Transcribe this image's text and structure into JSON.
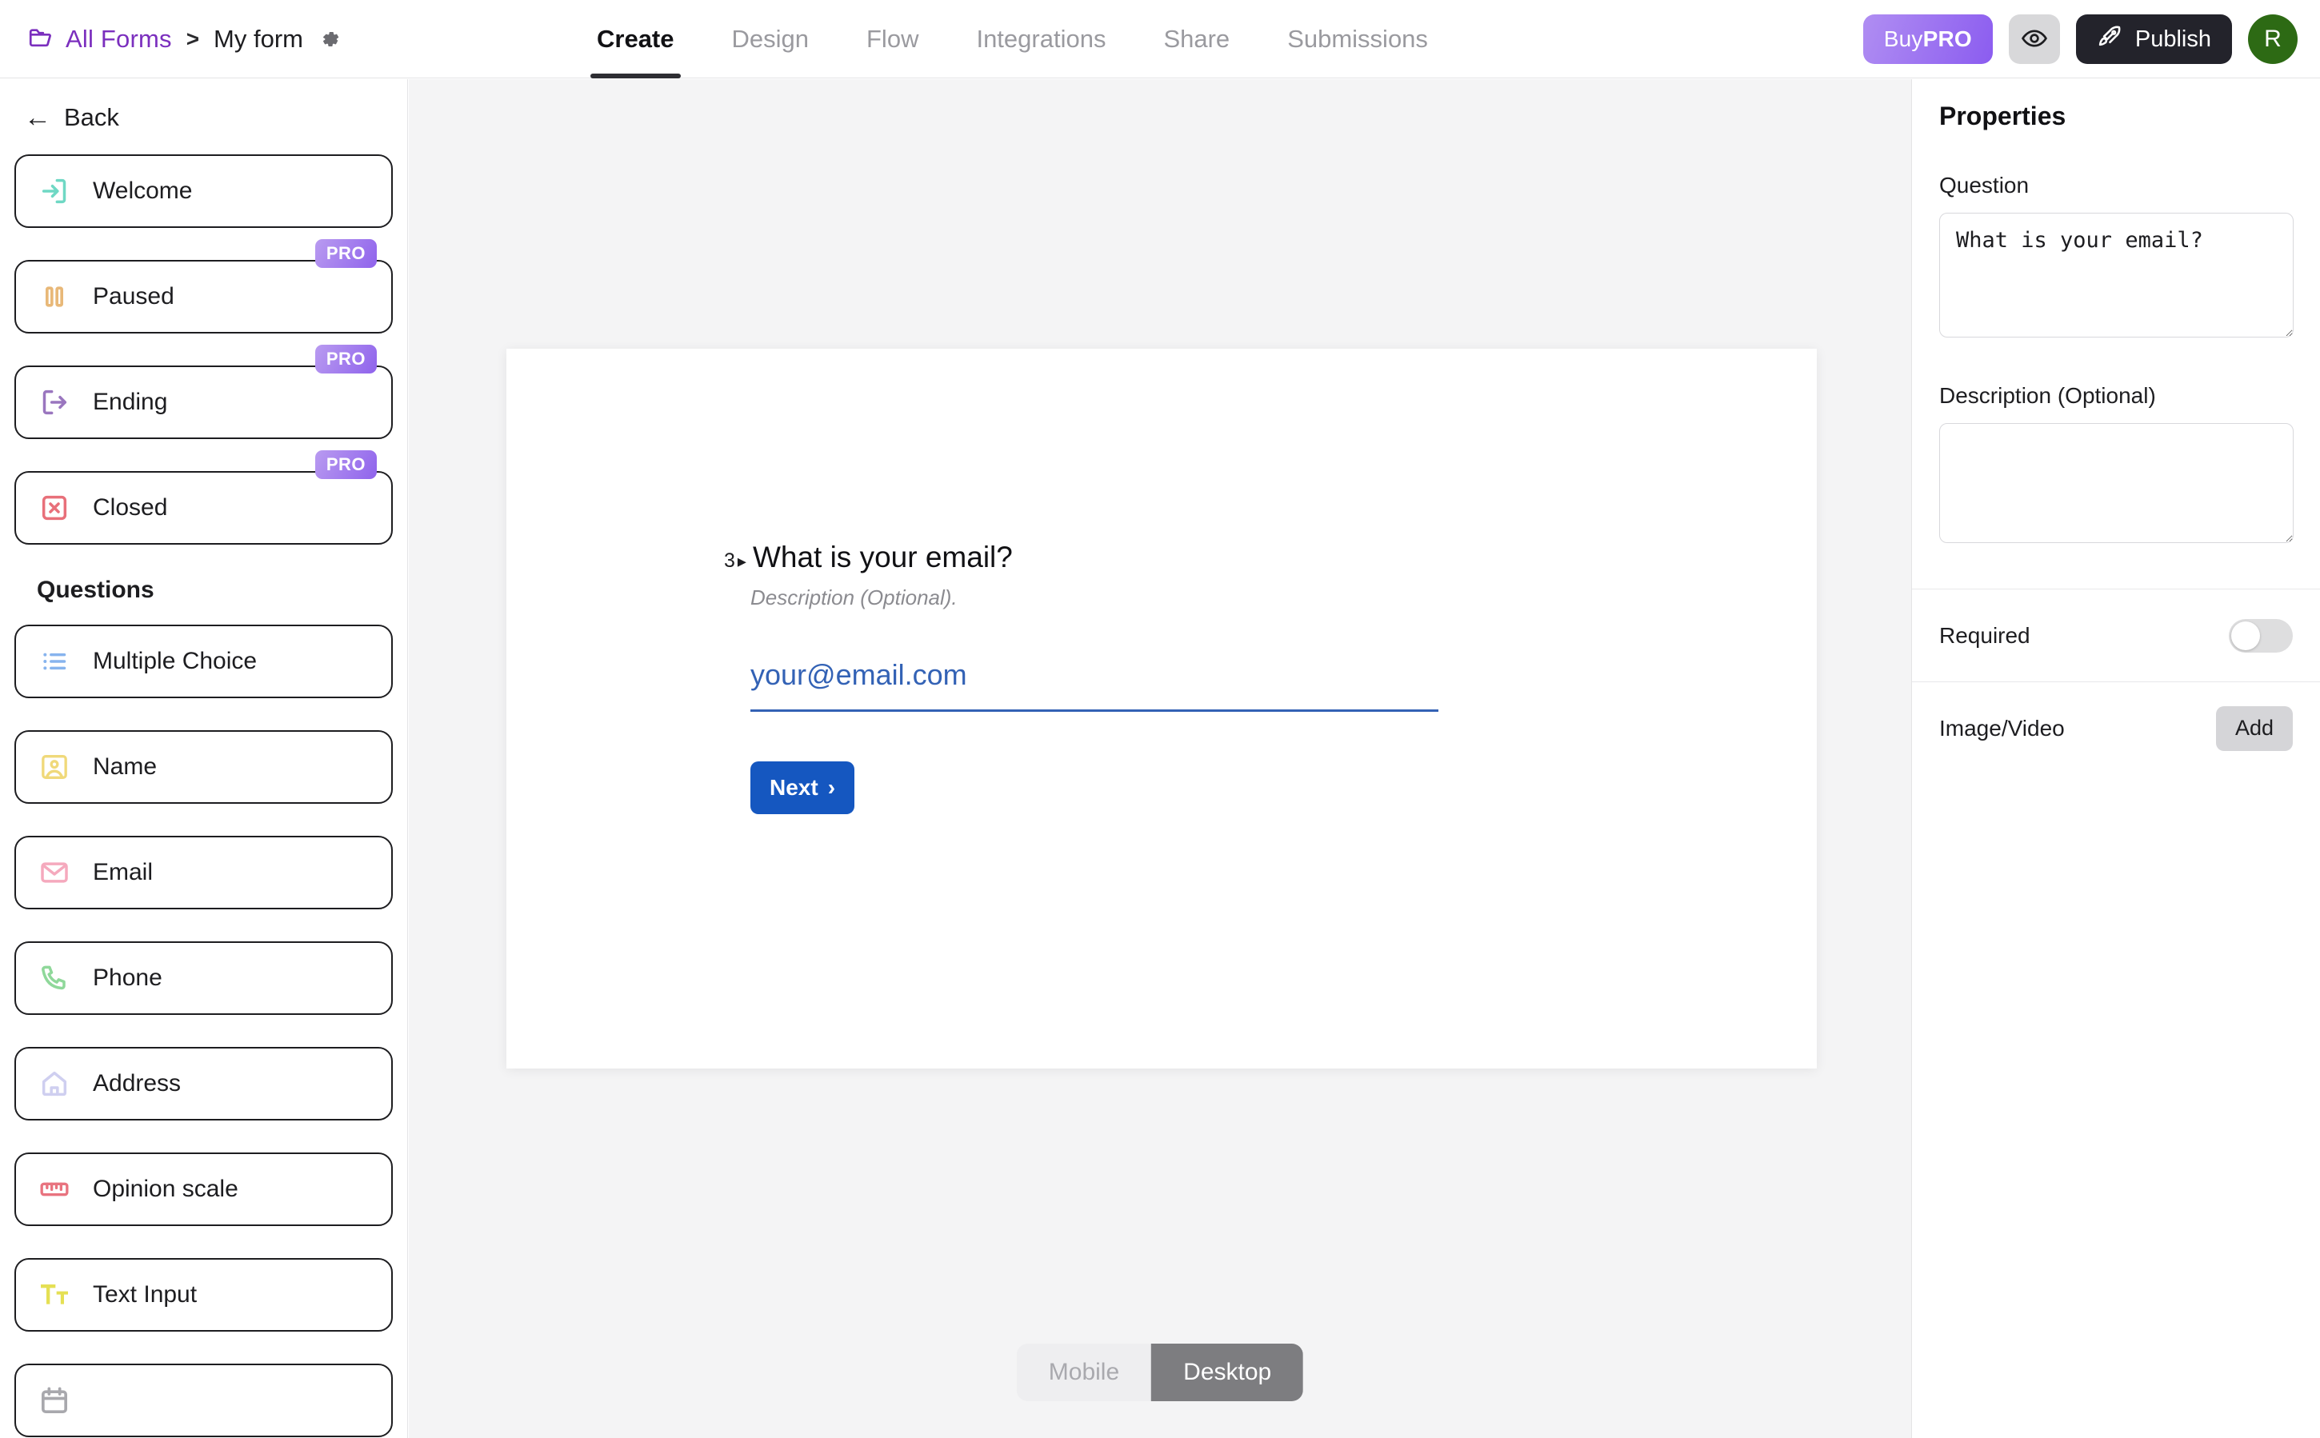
{
  "header": {
    "breadcrumb": {
      "all_forms": "All Forms",
      "separator": ">",
      "form_name": "My form"
    },
    "tabs": [
      {
        "label": "Create",
        "active": true
      },
      {
        "label": "Design",
        "active": false
      },
      {
        "label": "Flow",
        "active": false
      },
      {
        "label": "Integrations",
        "active": false
      },
      {
        "label": "Share",
        "active": false
      },
      {
        "label": "Submissions",
        "active": false
      }
    ],
    "buy_pro": {
      "prefix": "Buy",
      "suffix": "PRO"
    },
    "publish_label": "Publish",
    "avatar_initial": "R"
  },
  "sidebar": {
    "back_label": "Back",
    "screens": [
      {
        "label": "Welcome",
        "icon": "login-arrow-icon",
        "color": "#6fd8c4",
        "pro": false
      },
      {
        "label": "Paused",
        "icon": "pause-icon",
        "color": "#e8b878",
        "pro": true,
        "pro_label": "PRO"
      },
      {
        "label": "Ending",
        "icon": "logout-arrow-icon",
        "color": "#9a76bf",
        "pro": true,
        "pro_label": "PRO"
      },
      {
        "label": "Closed",
        "icon": "x-square-icon",
        "color": "#e8707a",
        "pro": true,
        "pro_label": "PRO"
      }
    ],
    "questions_title": "Questions",
    "questions": [
      {
        "label": "Multiple Choice",
        "icon": "list-bullet-icon",
        "color": "#87b4ee"
      },
      {
        "label": "Name",
        "icon": "person-frame-icon",
        "color": "#f0d97a"
      },
      {
        "label": "Email",
        "icon": "envelope-icon",
        "color": "#f5a9bd"
      },
      {
        "label": "Phone",
        "icon": "phone-icon",
        "color": "#8fd89a"
      },
      {
        "label": "Address",
        "icon": "home-icon",
        "color": "#cfcff0"
      },
      {
        "label": "Opinion scale",
        "icon": "ruler-icon",
        "color": "#e8737f"
      },
      {
        "label": "Text Input",
        "icon": "text-tt-icon",
        "color": "#e5e054"
      },
      {
        "label": "",
        "icon": "calendar-icon",
        "color": "#a8a8ad"
      }
    ]
  },
  "canvas": {
    "question": {
      "number": "3",
      "caret": "▸",
      "title": "What is your email?",
      "description": "Description (Optional).",
      "input_placeholder": "your@email.com"
    },
    "next_label": "Next",
    "next_chevron": "›",
    "device": {
      "mobile": "Mobile",
      "desktop": "Desktop",
      "selected": "Desktop"
    }
  },
  "properties": {
    "title": "Properties",
    "question_label": "Question",
    "question_value": "What is your email?",
    "description_label": "Description (Optional)",
    "description_value": "",
    "required_label": "Required",
    "required_on": false,
    "image_video_label": "Image/Video",
    "add_label": "Add"
  },
  "colors": {
    "accent_purple": "#7b2fbe",
    "pro_gradient_start": "#b99bf0",
    "pro_gradient_end": "#8f63ec",
    "publish_dark": "#23232b",
    "avatar_green": "#2d6a14",
    "next_blue": "#1557c0",
    "input_blue": "#3362b5",
    "canvas_bg": "#f4f4f5"
  }
}
